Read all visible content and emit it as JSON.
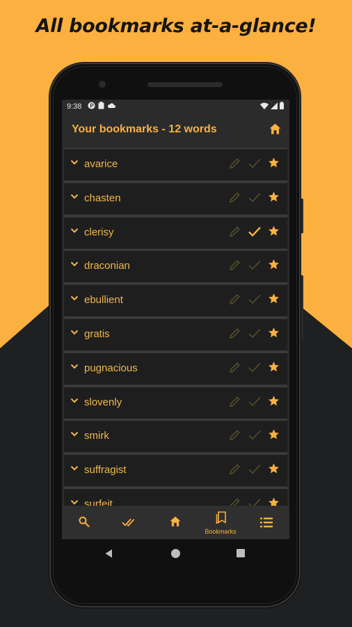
{
  "headline": "All bookmarks at-a-glance!",
  "status": {
    "time": "9:38"
  },
  "appbar": {
    "title": "Your bookmarks - 12 words"
  },
  "rows": [
    {
      "word": "avarice",
      "checked": false
    },
    {
      "word": "chasten",
      "checked": false
    },
    {
      "word": "clerisy",
      "checked": true
    },
    {
      "word": "draconian",
      "checked": false
    },
    {
      "word": "ebullient",
      "checked": false
    },
    {
      "word": "gratis",
      "checked": false
    },
    {
      "word": "pugnacious",
      "checked": false
    },
    {
      "word": "slovenly",
      "checked": false
    },
    {
      "word": "smirk",
      "checked": false
    },
    {
      "word": "suffragist",
      "checked": false
    },
    {
      "word": "surfeit",
      "checked": false
    }
  ],
  "bottomnav": {
    "bookmarks_label": "Bookmarks"
  },
  "colors": {
    "accent": "#FBB040",
    "background_dark": "#1f2021",
    "row_bg": "#1e1e1e"
  },
  "icons": [
    "search-icon",
    "double-check-icon",
    "home-icon",
    "bookmarks-icon",
    "list-icon",
    "pencil-icon",
    "check-icon",
    "star-icon",
    "chevron-down-icon"
  ]
}
